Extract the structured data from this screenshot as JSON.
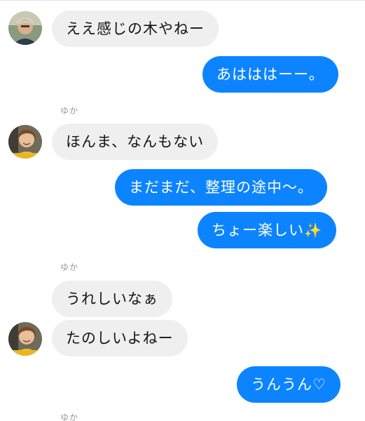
{
  "messages": [
    {
      "id": "m1",
      "side": "incoming",
      "text": "ええ感じの木やねー"
    },
    {
      "id": "m2",
      "side": "outgoing",
      "text": "あはははーー。"
    },
    {
      "id": "m3",
      "side": "incoming",
      "sender": "ゆか",
      "text": "ほんま、なんもない"
    },
    {
      "id": "m4",
      "side": "outgoing",
      "text": "まだまだ、整理の途中〜。"
    },
    {
      "id": "m5",
      "side": "outgoing",
      "text": "ちょー楽しい",
      "emoji": "✨"
    },
    {
      "id": "m6",
      "side": "incoming",
      "sender": "ゆか",
      "text": "うれしいなぁ"
    },
    {
      "id": "m7",
      "side": "incoming",
      "text": "たのしいよねー"
    },
    {
      "id": "m8",
      "side": "outgoing",
      "text": "うんうん♡"
    },
    {
      "id": "m9",
      "side": "incoming",
      "sender": "ゆか"
    }
  ],
  "avatars": {
    "contact_a": {
      "icon": "avatar-photo-man"
    },
    "contact_b": {
      "icon": "avatar-photo-yuka"
    }
  },
  "colors": {
    "outgoing_bubble": "#0d84ff",
    "incoming_bubble": "#efefef",
    "outgoing_text": "#ffffff",
    "incoming_text": "#141414",
    "sender_name": "#9a9a9a"
  }
}
